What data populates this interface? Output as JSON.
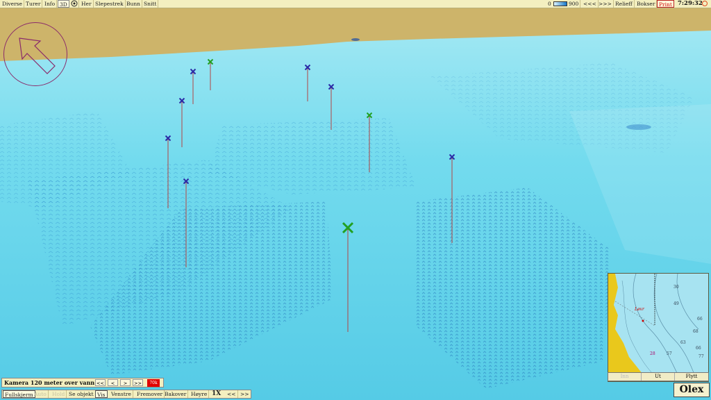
{
  "top_menu": {
    "items": [
      "Diverse",
      "Turer",
      "Info",
      "3D",
      "Her",
      "Slepestrek",
      "Bunn",
      "Snitt"
    ],
    "depth_min": "0",
    "depth_max": "900",
    "prev": "<<<",
    "next": ">>>",
    "relieff": "Relieff",
    "bokser": "Bokser",
    "print": "Print",
    "clock": "7:29:32"
  },
  "camera": {
    "label": "Kamera 120 meter over vann",
    "btn_first": "<<",
    "btn_prev": "<",
    "btn_next": ">",
    "btn_last": ">>",
    "red_value": "70k"
  },
  "bottom_menu": {
    "items": [
      "Fullskjerm",
      "Auto",
      "Hold",
      "Se objekt",
      "Vis",
      "Venstre",
      "Fremover",
      "Bakover",
      "Høyre"
    ],
    "speed": "1X",
    "speed_prev": "<<",
    "speed_next": ">>"
  },
  "inset": {
    "buttons": [
      "Inn",
      "Ut",
      "Flytt"
    ],
    "depths": [
      "30",
      "49",
      "66",
      "68",
      "63",
      "66",
      "57",
      "77",
      "28"
    ],
    "place": "Løvr"
  },
  "brand": "Olex",
  "colors": {
    "land": "#cdb46a",
    "sea": "#5fd3e8",
    "blue_marker": "#2b2aa6",
    "green_marker": "#22a022",
    "marker_line": "#b24444",
    "print": "#d01010"
  }
}
